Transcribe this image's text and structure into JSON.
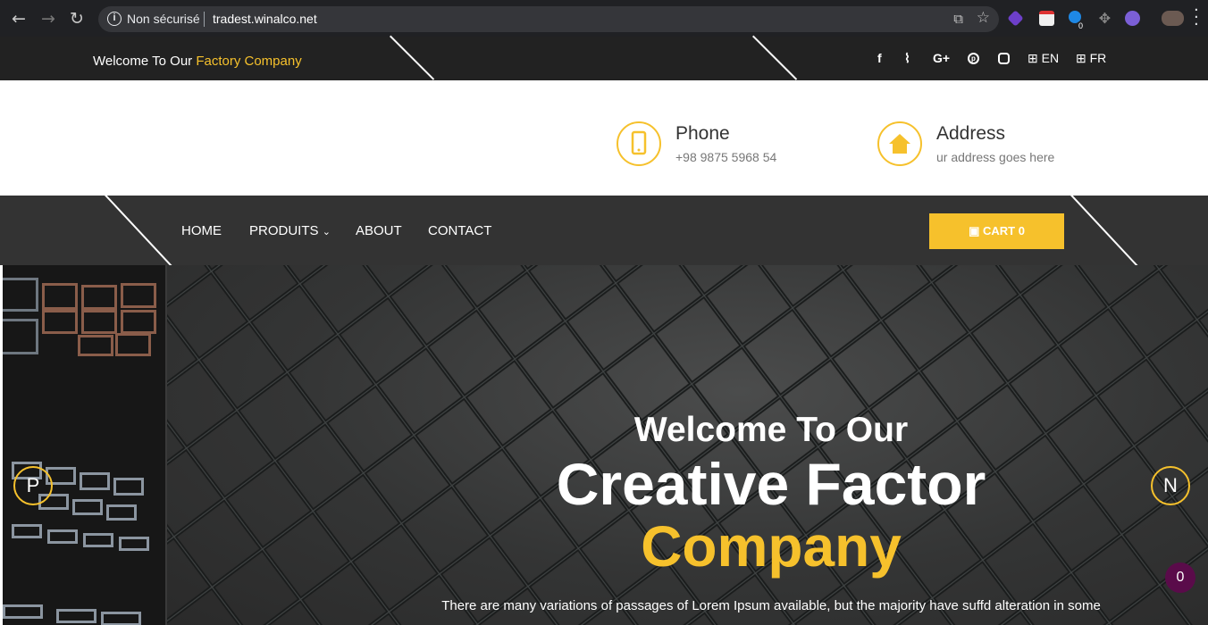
{
  "browser": {
    "security_label": "Non sécurisé",
    "url": "tradest.winalco.net",
    "extension_badge": "0"
  },
  "topbar": {
    "welcome_text": "Welcome To Our",
    "welcome_highlight": "Factory Company",
    "social_icons": [
      "facebook-icon",
      "rss-icon",
      "google-plus-icon",
      "pinterest-icon",
      "instagram-icon"
    ],
    "languages": [
      "EN",
      "FR"
    ]
  },
  "contact": {
    "phone_title": "Phone",
    "phone_value": "+98 9875 5968 54",
    "address_title": "Address",
    "address_value": "ur address goes here"
  },
  "nav": {
    "items": [
      "HOME",
      "PRODUITS",
      "ABOUT",
      "CONTACT"
    ],
    "cart_label": "CART 0"
  },
  "hero": {
    "line1": "Welcome To Our",
    "line2": "Creative Factor",
    "line3": "Company",
    "description": "There are many variations of passages of Lorem Ipsum available, but the majority have suffd alteration in some",
    "prev_label": "P",
    "next_label": "N"
  },
  "floating_badge": "0",
  "colors": {
    "accent": "#f6c12c",
    "dark": "#222222",
    "nav": "#333333"
  }
}
